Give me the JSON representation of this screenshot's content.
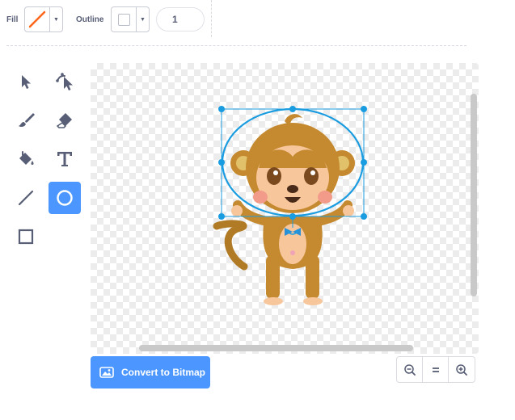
{
  "toolbar": {
    "fill_label": "Fill",
    "outline_label": "Outline",
    "stroke_width": "1",
    "fill_color": "#ff661a"
  },
  "tools": [
    {
      "name": "select-tool",
      "icon": "arrow-pointer-icon",
      "active": false
    },
    {
      "name": "reshape-tool",
      "icon": "reshape-pointer-icon",
      "active": false
    },
    {
      "name": "brush-tool",
      "icon": "brush-icon",
      "active": false
    },
    {
      "name": "eraser-tool",
      "icon": "eraser-icon",
      "active": false
    },
    {
      "name": "fill-tool",
      "icon": "paint-bucket-icon",
      "active": false
    },
    {
      "name": "text-tool",
      "icon": "text-t-icon",
      "active": false
    },
    {
      "name": "line-tool",
      "icon": "line-icon",
      "active": false
    },
    {
      "name": "circle-tool",
      "icon": "circle-icon",
      "active": true
    },
    {
      "name": "rectangle-tool",
      "icon": "square-icon",
      "active": false
    }
  ],
  "canvas": {
    "selection_color": "#1a9ce0"
  },
  "footer": {
    "convert_label": "Convert to Bitmap",
    "zoom_out_icon": "zoom-out-icon",
    "zoom_reset_icon": "equals-icon",
    "zoom_in_icon": "zoom-in-icon"
  },
  "colors": {
    "accent": "#4c97ff",
    "text": "#575e75"
  }
}
